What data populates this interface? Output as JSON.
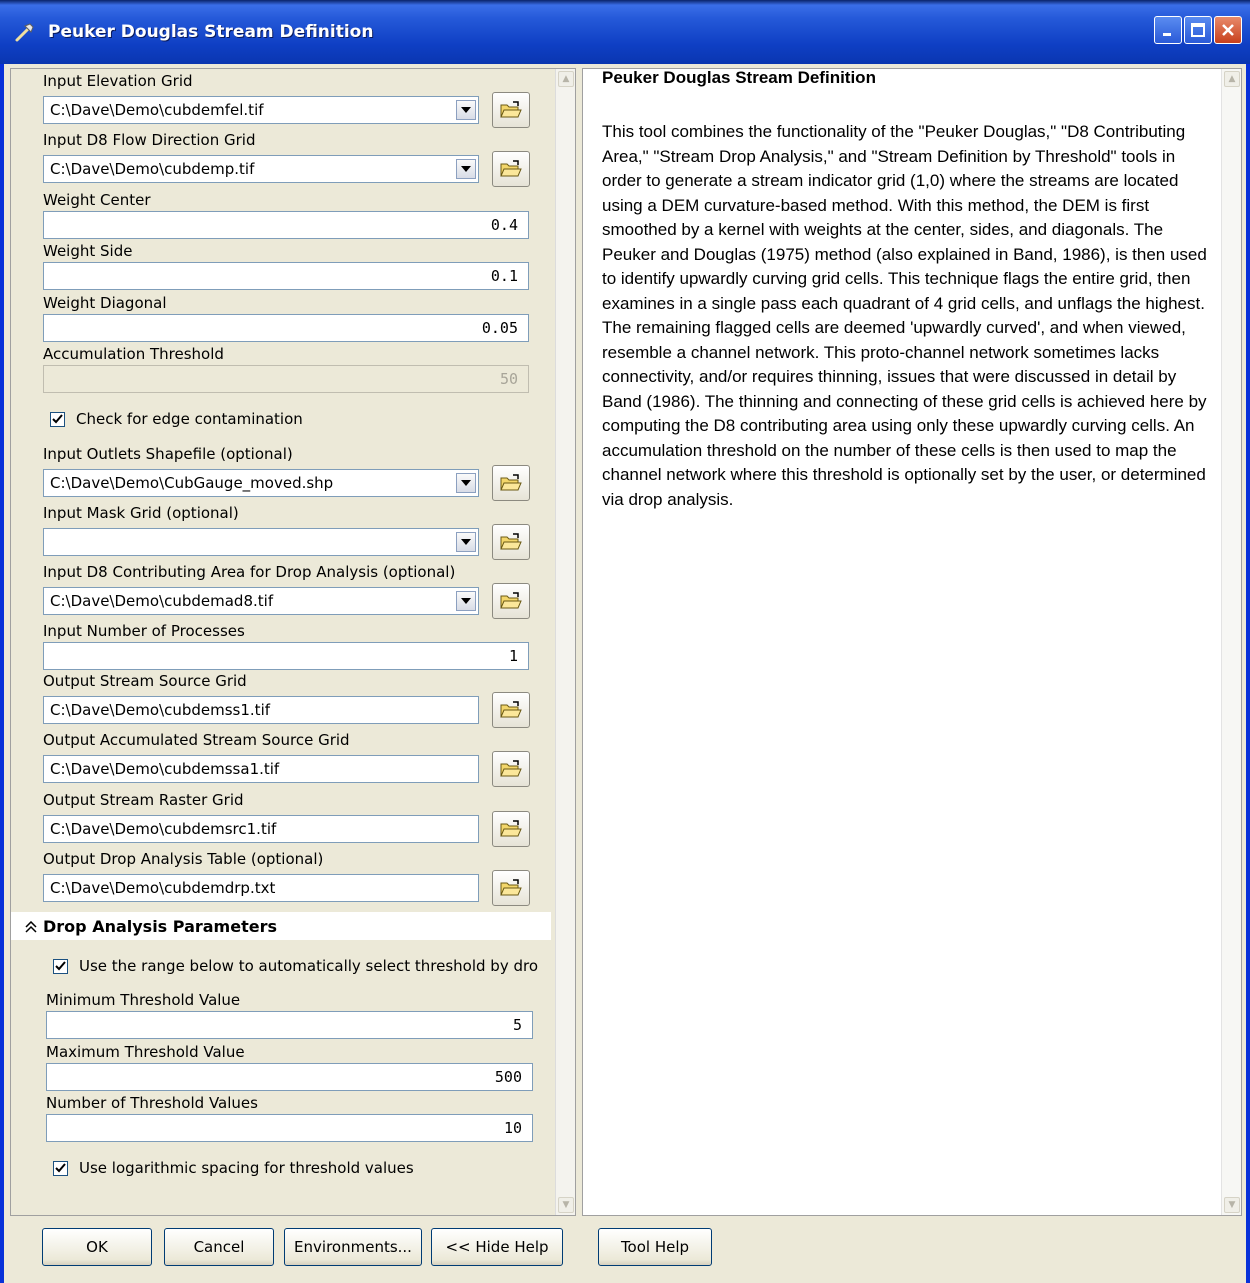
{
  "window": {
    "title": "Peuker Douglas Stream Definition"
  },
  "fields": {
    "input_elevation_grid": {
      "label": "Input Elevation Grid",
      "value": "C:\\Dave\\Demo\\cubdemfel.tif"
    },
    "input_d8_flow_direction": {
      "label": "Input D8 Flow Direction Grid",
      "value": "C:\\Dave\\Demo\\cubdemp.tif"
    },
    "weight_center": {
      "label": "Weight Center",
      "value": "0.4"
    },
    "weight_side": {
      "label": "Weight Side",
      "value": "0.1"
    },
    "weight_diagonal": {
      "label": "Weight Diagonal",
      "value": "0.05"
    },
    "accumulation_threshold": {
      "label": "Accumulation Threshold",
      "value": "50"
    },
    "edge_contamination": {
      "label": "Check for edge contamination",
      "checked": true
    },
    "input_outlets": {
      "label": "Input Outlets Shapefile (optional)",
      "value": "C:\\Dave\\Demo\\CubGauge_moved.shp"
    },
    "input_mask": {
      "label": "Input Mask Grid (optional)",
      "value": ""
    },
    "input_d8_contrib": {
      "label": "Input D8 Contributing Area for Drop Analysis (optional)",
      "value": "C:\\Dave\\Demo\\cubdemad8.tif"
    },
    "num_processes": {
      "label": "Input Number of Processes",
      "value": "1"
    },
    "out_stream_source": {
      "label": "Output Stream Source Grid",
      "value": "C:\\Dave\\Demo\\cubdemss1.tif"
    },
    "out_accum_stream_source": {
      "label": "Output Accumulated Stream Source Grid",
      "value": "C:\\Dave\\Demo\\cubdemssa1.tif"
    },
    "out_stream_raster": {
      "label": "Output Stream Raster Grid",
      "value": "C:\\Dave\\Demo\\cubdemsrc1.tif"
    },
    "out_drop_table": {
      "label": "Output Drop Analysis Table (optional)",
      "value": "C:\\Dave\\Demo\\cubdemdrp.txt"
    }
  },
  "drop_section": {
    "title": "Drop Analysis Parameters",
    "use_range_label": "Use the range below to automatically select threshold by drop ar",
    "use_range_checked": true,
    "min_label": "Minimum Threshold Value",
    "min_value": "5",
    "max_label": "Maximum Threshold Value",
    "max_value": "500",
    "num_label": "Number of Threshold Values",
    "num_value": "10",
    "log_label": "Use logarithmic spacing for threshold values",
    "log_checked": true
  },
  "help": {
    "title": "Peuker Douglas Stream Definition",
    "body": "This tool combines the functionality of the \"Peuker Douglas,\" \"D8 Contributing Area,\" \"Stream Drop Analysis,\" and \"Stream Definition by Threshold\" tools in order to generate a stream indicator grid (1,0) where the streams are located using a DEM curvature-based method. With this method, the DEM is first smoothed by a kernel with weights at the center, sides, and diagonals. The Peuker and Douglas (1975) method (also explained in Band, 1986), is then used to identify upwardly curving grid cells. This technique flags the entire grid, then examines in a single pass each quadrant of 4 grid cells, and unflags the highest. The remaining flagged cells are deemed 'upwardly curved', and when viewed, resemble a channel network. This proto-channel network sometimes lacks connectivity, and/or requires thinning, issues that were discussed in detail by Band (1986). The thinning and connecting of these grid cells is achieved here by computing the D8 contributing area using only these upwardly curving cells. An accumulation threshold on the number of these cells is then used to map the channel network where this threshold is optionally set by the user, or determined via drop analysis."
  },
  "buttons": {
    "ok": "OK",
    "cancel": "Cancel",
    "environments": "Environments...",
    "hide_help": "<< Hide Help",
    "tool_help": "Tool Help"
  }
}
